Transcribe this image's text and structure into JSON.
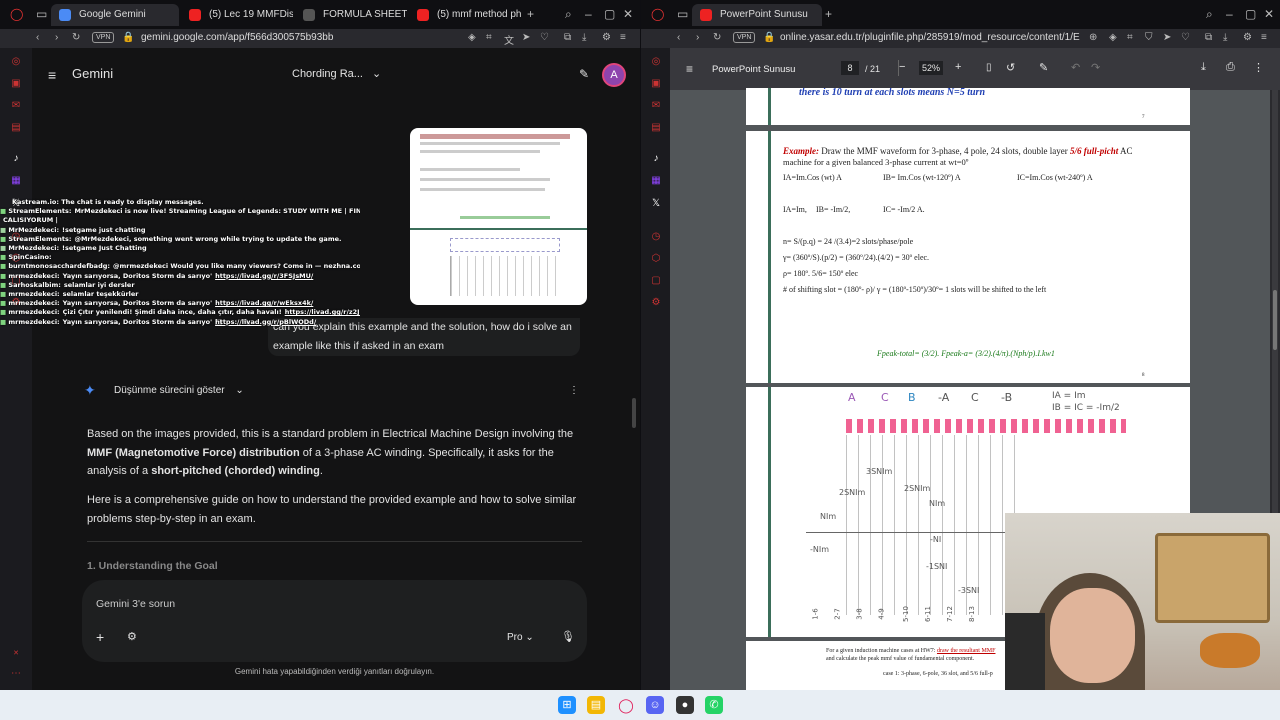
{
  "left_window": {
    "tabs": [
      {
        "label": "Google Gemini",
        "active": true
      },
      {
        "label": "(5) Lec 19 MMFDistrib"
      },
      {
        "label": "FORMULA SHEET-VE"
      },
      {
        "label": "(5) mmf method phas"
      }
    ],
    "url": "gemini.google.com/app/f566d300575b93bb",
    "vpn": "VPN",
    "gemini": {
      "title": "Gemini",
      "chat_title": "Chording Ra...",
      "avatar": "A",
      "user_prompt": "can you explain this example and the solution, how do i solve an example like this if asked in an exam",
      "thinking_toggle": "Düşünme sürecini göster",
      "para1_a": "Based on the images provided, this is a standard problem in Electrical Machine Design involving the ",
      "para1_b": "MMF (Magnetomotive Force) distribution",
      "para1_c": " of a 3-phase AC winding. Specifically, it asks for the analysis of a ",
      "para1_d": "short-pitched (chorded) winding",
      "para1_e": ".",
      "para2": "Here is a comprehensive guide on how to understand the provided example and how to solve similar problems step-by-step in an exam.",
      "section_heading": "1. Understanding the Goal",
      "input_placeholder": "Gemini 3'e sorun",
      "model": "Pro",
      "disclaimer": "Gemini hata yapabildiğinden verdiği yanıtları doğrulayın."
    },
    "chat_overlay": [
      {
        "user": "StreamElements:",
        "text": "MrMezdekeci is now live! Streaming League of Legends: STUDY WITH ME | FINALLERE"
      },
      {
        "user": "",
        "text": "CALISIYORUM |"
      },
      {
        "user": "MrMezdekeci:",
        "text": "!setgame just chatting"
      },
      {
        "user": "StreamElements:",
        "text": "@MrMezdekeci, something went wrong while trying to update the game."
      },
      {
        "user": "MrMezdekeci:",
        "text": "!setgame Just Chatting"
      },
      {
        "user": "SpinCasino:",
        "text": ""
      },
      {
        "user": "burntmonosacchardefbadg:",
        "text": "@mrmezdekeci Would you like many viewers? Come in — nezhna.com"
      },
      {
        "user": "mrmezdekeci:",
        "text": "Yayın sarıyorsa, Doritos Storm da sarıyo'",
        "link": "https://livad.gg/r/3FSJsMU/"
      },
      {
        "user": "Sarhoskalbim:",
        "text": "selamlar iyi dersler"
      },
      {
        "user": "mrmezdekeci:",
        "text": "selamlar teşekkürler"
      },
      {
        "user": "mrmezdekeci:",
        "text": "Yayın sarıyorsa, Doritos Storm da sarıyo'",
        "link": "https://livad.gg/r/wEksx4k/"
      },
      {
        "user": "mrmezdekeci:",
        "text": "Çizi Çıtır yenilendi! Şimdi daha ince, daha çıtır, daha havalı!",
        "link": "https://livad.gg/r/z2JR9FI/"
      },
      {
        "user": "mrmezdekeci:",
        "text": "Yayın sarıyorsa, Doritos Storm da sarıyo'",
        "link": "https://livad.gg/r/pBlWODd/"
      }
    ],
    "chat_status": "Kastream.io: The chat is ready to display messages."
  },
  "right_window": {
    "tabs": [
      {
        "label": "PowerPoint Sunusu",
        "active": true
      }
    ],
    "url": "online.yasar.edu.tr/pluginfile.php/285919/mod_resource/content/1/EEE%2",
    "vpn": "VPN",
    "pdf": {
      "title": "PowerPoint Sunusu",
      "page_current": "8",
      "page_total": "/ 21",
      "zoom": "52%",
      "page7_text": "there is 10 turn at each slots means N=5 turn",
      "page7_num": "7",
      "page8_num": "8",
      "example_label": "Example:",
      "example_text": "Draw the MMF waveform for 3-phase, 4 pole, 24 slots, double layer",
      "example_pitch": "5/6 full-picht",
      "example_text2": "AC",
      "example_line2": "machine for a given balanced 3-phase current at wt=0º",
      "currents": [
        "IA=Im.Cos (wt) A",
        "IB= Im.Cos (wt-120º) A",
        "IC=Im.Cos (wt-240º) A"
      ],
      "currents2": [
        "IA=Im,",
        "IB= -Im/2,",
        "IC= -Im/2 A."
      ],
      "calc": [
        "n=  S/(p.q) = 24 /(3.4)=2 slots/phase/pole",
        "γ= (360º/S).(p/2) = (360º/24).(4/2) = 30º  elec.",
        "ρ= 180º. 5/6= 150º elec",
        "# of shifting slot = (180º- ρ)/ γ = (180º-150º)/30º= 1 slots will be shifted to the left"
      ],
      "fpeak": "Fpeak-total= (3/2). Fpeak-a= (3/2).(4/π).(Nph/p).I.kw1",
      "hand_labels": [
        "A",
        "C",
        "B",
        "-A",
        "C",
        "-B"
      ],
      "hand_current": "IA = Im",
      "hand_current2": "IB = IC = -Im/2",
      "mmf_labels": [
        "3SNIm",
        "2SNIm",
        "2SNIm",
        "NIm",
        "NIm",
        "-NIm",
        "-NI",
        "-1SNI",
        "-3SNI"
      ],
      "slot_pairs": [
        "1-6",
        "2-7",
        "3-8",
        "4-9",
        "5-10",
        "6-11",
        "7-12",
        "8-13"
      ],
      "next_text": "For a given induction machine cases at HW7:",
      "next_text_u": "draw the resultant MMF",
      "next_text2": "and calculate the peak mmf value of fundamental component.",
      "case1": "case 1: 3-phase, 6-pole, 36 slot, and 5/6 full-p"
    }
  },
  "colors": {
    "gemini_accent": "#4b8bf5",
    "slide_red": "#c00000",
    "slide_blue": "#1f3fb3",
    "slide_green_bar": "#3b6e5a"
  }
}
